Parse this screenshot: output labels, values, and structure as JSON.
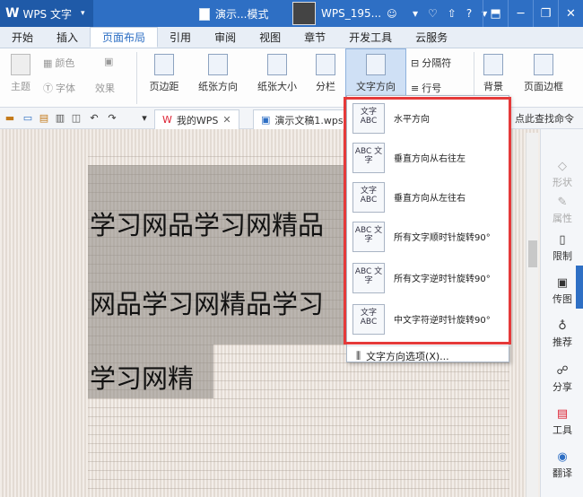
{
  "app": {
    "logo": "W",
    "name": "WPS 文字",
    "menu_arrow": "▾"
  },
  "title": {
    "doc": "演示...模式"
  },
  "user": {
    "name": "WPS_195...",
    "status_icon": "☺"
  },
  "toolbar_icons": [
    "▾",
    "♡",
    "⇧",
    "?",
    "▾"
  ],
  "window": {
    "min": "─",
    "restore": "❐",
    "close": "✕",
    "home": "⬒"
  },
  "tabs": [
    "开始",
    "插入",
    "页面布局",
    "引用",
    "审阅",
    "视图",
    "章节",
    "开发工具",
    "云服务"
  ],
  "active_tab": "页面布局",
  "ribbon": {
    "theme": "主题",
    "color": "颜色",
    "font": "字体",
    "effect": "效果",
    "margins": "页边距",
    "orientation": "纸张方向",
    "size": "纸张大小",
    "columns": "分栏",
    "text_direction": "文字方向",
    "breaks": "分隔符",
    "line_numbers": "行号",
    "background": "背景",
    "page_border": "页面边框"
  },
  "quickbar": {
    "doc_tabs": [
      {
        "label": "我的WPS",
        "icon": "W"
      },
      {
        "label": "演示文稿1.wps *",
        "icon": "▣"
      }
    ],
    "find_command": "点此查找命令"
  },
  "document": {
    "lines": [
      "学习网品学习网精品",
      "网品学习网精品学习",
      "学习网精"
    ]
  },
  "right_panel": [
    "形状",
    "属性",
    "限制",
    "传图",
    "推荐",
    "分享",
    "工具",
    "翻译"
  ],
  "dropdown": {
    "options": [
      {
        "label": "水平方向",
        "icon_text": "文字 ABC"
      },
      {
        "label": "垂直方向从右往左",
        "icon_text": "ABC 文字"
      },
      {
        "label": "垂直方向从左往右",
        "icon_text": "文字 ABC"
      },
      {
        "label": "所有文字顺时针旋转90°",
        "icon_text": "ABC 文字"
      },
      {
        "label": "所有文字逆时针旋转90°",
        "icon_text": "ABC 文字"
      },
      {
        "label": "中文字符逆时针旋转90°",
        "icon_text": "文字 ABC"
      }
    ],
    "more": "文字方向选项(X)..."
  },
  "colors": {
    "title_bar": "#2e6fc4",
    "highlight_box": "#e53a3a",
    "accent": "#2e6fc4"
  }
}
